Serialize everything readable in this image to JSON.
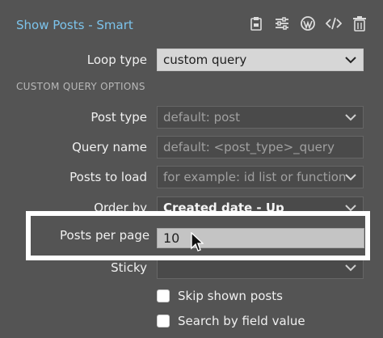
{
  "header": {
    "title": "Show Posts - Smart",
    "toolbar": [
      "clipboard-icon",
      "sliders-icon",
      "wordpress-icon",
      "code-icon",
      "trash-icon"
    ]
  },
  "fields": {
    "loop_type": {
      "label": "Loop type",
      "value": "custom query"
    },
    "section_title": "CUSTOM QUERY OPTIONS",
    "post_type": {
      "label": "Post type",
      "placeholder": "default: post"
    },
    "query_name": {
      "label": "Query name",
      "placeholder": "default: <post_type>_query"
    },
    "posts_to_load": {
      "label": "Posts to load",
      "placeholder": "for example: id list or function"
    },
    "order_by": {
      "label": "Order by",
      "value": "Created date - Up"
    },
    "posts_per_page": {
      "label": "Posts per page",
      "value": "10"
    },
    "sticky": {
      "label": "Sticky",
      "value": ""
    }
  },
  "checkboxes": [
    {
      "label": "Skip shown posts",
      "checked": false
    },
    {
      "label": "Search by field value",
      "checked": false
    }
  ],
  "colors": {
    "accent": "#7cc4ec",
    "panel": "#545454",
    "highlight_border": "#ffffff"
  }
}
